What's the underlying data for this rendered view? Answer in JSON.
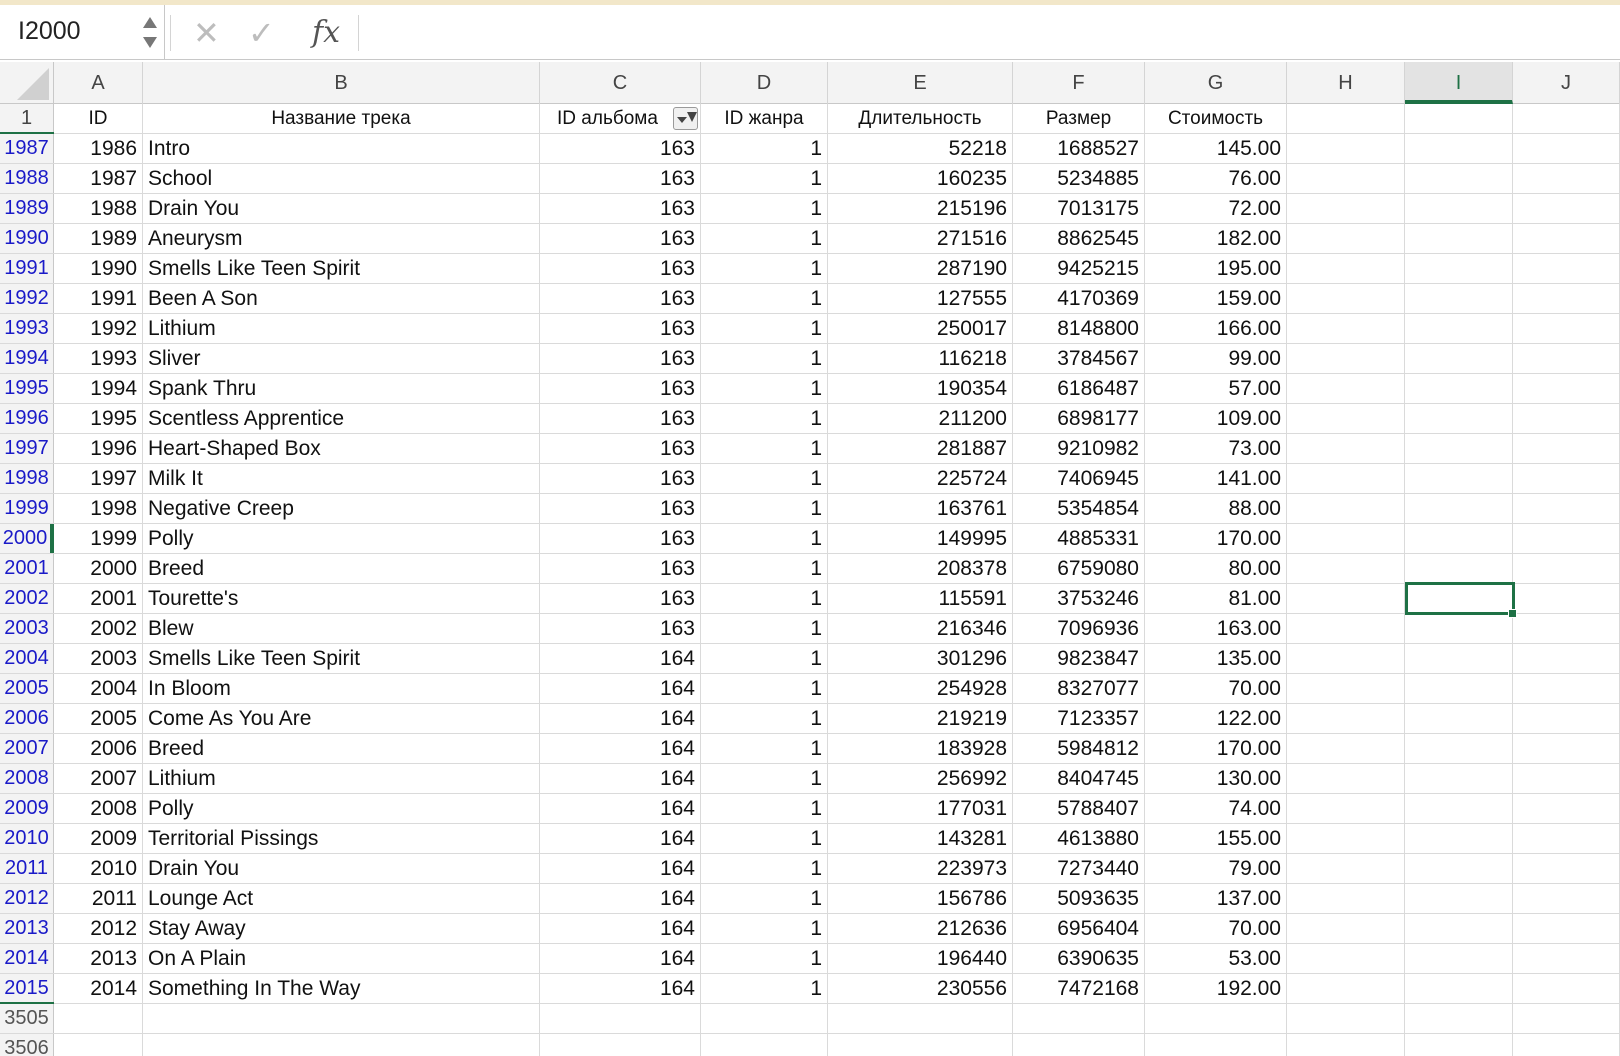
{
  "name_box": {
    "value": "I2000"
  },
  "formula_bar": {
    "cancel_icon": "✕",
    "confirm_icon": "✓",
    "fx_label": "fx",
    "value": ""
  },
  "columns": [
    "A",
    "B",
    "C",
    "D",
    "E",
    "F",
    "G",
    "H",
    "I",
    "J"
  ],
  "selected_column": "I",
  "header_row": {
    "rownum": "1",
    "cells": [
      "ID",
      "Название трека",
      "ID альбома",
      "ID жанра",
      "Длительность",
      "Размер",
      "Стоимость"
    ]
  },
  "rows": [
    {
      "rownum": "1987",
      "cells": [
        "1986",
        "Intro",
        "163",
        "1",
        "52218",
        "1688527",
        "145.00"
      ]
    },
    {
      "rownum": "1988",
      "cells": [
        "1987",
        "School",
        "163",
        "1",
        "160235",
        "5234885",
        "76.00"
      ]
    },
    {
      "rownum": "1989",
      "cells": [
        "1988",
        "Drain You",
        "163",
        "1",
        "215196",
        "7013175",
        "72.00"
      ]
    },
    {
      "rownum": "1990",
      "cells": [
        "1989",
        "Aneurysm",
        "163",
        "1",
        "271516",
        "8862545",
        "182.00"
      ]
    },
    {
      "rownum": "1991",
      "cells": [
        "1990",
        "Smells Like Teen Spirit",
        "163",
        "1",
        "287190",
        "9425215",
        "195.00"
      ]
    },
    {
      "rownum": "1992",
      "cells": [
        "1991",
        "Been A Son",
        "163",
        "1",
        "127555",
        "4170369",
        "159.00"
      ]
    },
    {
      "rownum": "1993",
      "cells": [
        "1992",
        "Lithium",
        "163",
        "1",
        "250017",
        "8148800",
        "166.00"
      ]
    },
    {
      "rownum": "1994",
      "cells": [
        "1993",
        "Sliver",
        "163",
        "1",
        "116218",
        "3784567",
        "99.00"
      ]
    },
    {
      "rownum": "1995",
      "cells": [
        "1994",
        "Spank Thru",
        "163",
        "1",
        "190354",
        "6186487",
        "57.00"
      ]
    },
    {
      "rownum": "1996",
      "cells": [
        "1995",
        "Scentless Apprentice",
        "163",
        "1",
        "211200",
        "6898177",
        "109.00"
      ]
    },
    {
      "rownum": "1997",
      "cells": [
        "1996",
        "Heart-Shaped Box",
        "163",
        "1",
        "281887",
        "9210982",
        "73.00"
      ]
    },
    {
      "rownum": "1998",
      "cells": [
        "1997",
        "Milk It",
        "163",
        "1",
        "225724",
        "7406945",
        "141.00"
      ]
    },
    {
      "rownum": "1999",
      "cells": [
        "1998",
        "Negative Creep",
        "163",
        "1",
        "163761",
        "5354854",
        "88.00"
      ]
    },
    {
      "rownum": "2000",
      "cells": [
        "1999",
        "Polly",
        "163",
        "1",
        "149995",
        "4885331",
        "170.00"
      ]
    },
    {
      "rownum": "2001",
      "cells": [
        "2000",
        "Breed",
        "163",
        "1",
        "208378",
        "6759080",
        "80.00"
      ]
    },
    {
      "rownum": "2002",
      "cells": [
        "2001",
        "Tourette's",
        "163",
        "1",
        "115591",
        "3753246",
        "81.00"
      ]
    },
    {
      "rownum": "2003",
      "cells": [
        "2002",
        "Blew",
        "163",
        "1",
        "216346",
        "7096936",
        "163.00"
      ]
    },
    {
      "rownum": "2004",
      "cells": [
        "2003",
        "Smells Like Teen Spirit",
        "164",
        "1",
        "301296",
        "9823847",
        "135.00"
      ]
    },
    {
      "rownum": "2005",
      "cells": [
        "2004",
        "In Bloom",
        "164",
        "1",
        "254928",
        "8327077",
        "70.00"
      ]
    },
    {
      "rownum": "2006",
      "cells": [
        "2005",
        "Come As You Are",
        "164",
        "1",
        "219219",
        "7123357",
        "122.00"
      ]
    },
    {
      "rownum": "2007",
      "cells": [
        "2006",
        "Breed",
        "164",
        "1",
        "183928",
        "5984812",
        "170.00"
      ]
    },
    {
      "rownum": "2008",
      "cells": [
        "2007",
        "Lithium",
        "164",
        "1",
        "256992",
        "8404745",
        "130.00"
      ]
    },
    {
      "rownum": "2009",
      "cells": [
        "2008",
        "Polly",
        "164",
        "1",
        "177031",
        "5788407",
        "74.00"
      ]
    },
    {
      "rownum": "2010",
      "cells": [
        "2009",
        "Territorial Pissings",
        "164",
        "1",
        "143281",
        "4613880",
        "155.00"
      ]
    },
    {
      "rownum": "2011",
      "cells": [
        "2010",
        "Drain You",
        "164",
        "1",
        "223973",
        "7273440",
        "79.00"
      ]
    },
    {
      "rownum": "2012",
      "cells": [
        "2011",
        "Lounge Act",
        "164",
        "1",
        "156786",
        "5093635",
        "137.00"
      ]
    },
    {
      "rownum": "2013",
      "cells": [
        "2012",
        "Stay Away",
        "164",
        "1",
        "212636",
        "6956404",
        "70.00"
      ]
    },
    {
      "rownum": "2014",
      "cells": [
        "2013",
        "On A Plain",
        "164",
        "1",
        "196440",
        "6390635",
        "53.00"
      ]
    },
    {
      "rownum": "2015",
      "cells": [
        "2014",
        "Something In The Way",
        "164",
        "1",
        "230556",
        "7472168",
        "192.00"
      ]
    }
  ],
  "empty_rows": [
    "3505",
    "3506"
  ],
  "selected_row": "2000",
  "colors": {
    "accent": "#1e7145",
    "filtered_rownum": "#1a1ac8",
    "strip": "#f2e7c9"
  }
}
